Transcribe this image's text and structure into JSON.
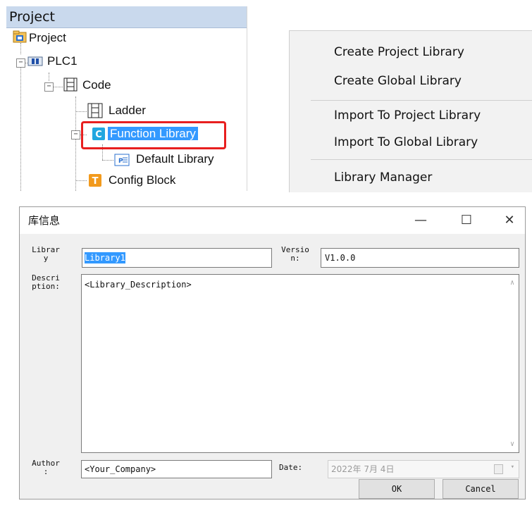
{
  "project_panel": {
    "header": "Project",
    "tree": {
      "root": "Project",
      "plc": "PLC1",
      "code": "Code",
      "ladder": "Ladder",
      "function_library": "Function Library",
      "default_library": "Default Library",
      "config_block": "Config Block"
    },
    "icons": {
      "project": "project-folder-icon",
      "plc": "plc-icon",
      "code": "code-icon",
      "ladder": "ladder-icon",
      "function_library": "function-library-icon",
      "default_library": "library-file-icon",
      "config_block": "config-block-icon"
    }
  },
  "context_menu": {
    "items": [
      "Create Project Library",
      "Create Global Library",
      "Import To Project Library",
      "Import To Global Library",
      "Library Manager"
    ]
  },
  "dialog": {
    "title": "库信息",
    "window_buttons": {
      "minimize": "—",
      "maximize": "☐",
      "close": "✕"
    },
    "library_label": "Librar y",
    "library_value": "Library1",
    "version_label": "Versio n:",
    "version_value": "V1.0.0",
    "description_label": "Descri ption:",
    "description_value": "<Library_Description>",
    "author_label": "Author :",
    "author_value": "<Your_Company>",
    "date_label": "Date:",
    "date_value": "2022年 7月 4日",
    "ok_label": "OK",
    "cancel_label": "Cancel"
  },
  "colors": {
    "selection": "#3399ff",
    "highlight_border": "#e81f1f",
    "panel_header": "#c9d9ed",
    "dialog_bg": "#f0f0f0"
  }
}
